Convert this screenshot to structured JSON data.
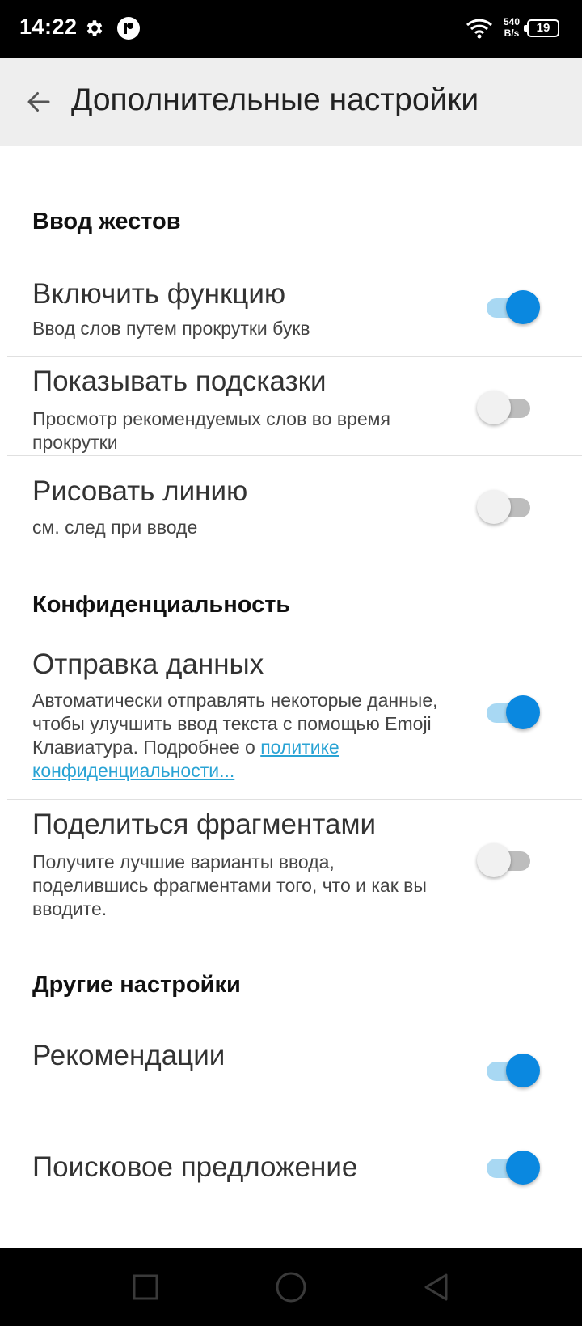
{
  "status_bar": {
    "time": "14:22",
    "net_speed_value": "540",
    "net_speed_unit": "B/s",
    "battery_level": "19",
    "icons": [
      "gear-icon",
      "app-notification-icon",
      "wifi-icon",
      "battery-icon"
    ]
  },
  "app_bar": {
    "back_icon": "arrow-left-icon",
    "title": "Дополнительные настройки"
  },
  "sections": {
    "gesture": {
      "title": "Ввод жестов",
      "items": [
        {
          "title": "Включить функцию",
          "subtitle": "Ввод слов путем прокрутки букв",
          "enabled": true
        },
        {
          "title": "Показывать подсказки",
          "subtitle": "Просмотр рекомендуемых слов во время прокрутки",
          "enabled": false
        },
        {
          "title": "Рисовать линию",
          "subtitle": "см. след при вводе",
          "enabled": false
        }
      ]
    },
    "privacy": {
      "title": "Конфиденциальность",
      "items": [
        {
          "title": "Отправка данных",
          "subtitle": "Автоматически отправлять некоторые данные, чтобы улучшить ввод текста с помощью Emoji Клавиатура. Подробнее о",
          "link": "политике конфиденциальности...",
          "enabled": true
        },
        {
          "title": "Поделиться фрагментами",
          "subtitle": "Получите лучшие варианты ввода, поделившись фрагментами того, что и как вы вводите.",
          "enabled": false
        }
      ]
    },
    "other": {
      "title": "Другие настройки",
      "items": [
        {
          "title": "Рекомендации",
          "enabled": true
        },
        {
          "title": "Поисковое предложение",
          "enabled": true
        }
      ]
    }
  },
  "nav_bar": {
    "icons": [
      "recents-square-icon",
      "home-circle-icon",
      "back-triangle-icon"
    ]
  },
  "colors": {
    "accent": "#0a88e0",
    "accent_track": "#a8d8f3",
    "link": "#29a3d4",
    "app_bar_bg": "#eeeeee"
  }
}
